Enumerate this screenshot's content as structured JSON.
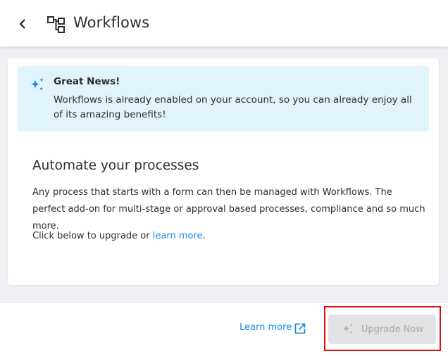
{
  "header": {
    "back_icon": "chevron-left-icon",
    "app_icon": "workflow-icon",
    "title": "Workflows"
  },
  "notice": {
    "icon": "sparkle-icon",
    "title": "Great News!",
    "body": "Workflows is already enabled on your account, so you can already enjoy all of its amazing benefits!",
    "background": "#e1f4fb",
    "icon_color": "#1b8ae0"
  },
  "main": {
    "title": "Automate your processes",
    "description": "Any process that starts with a form can then be managed with Workflows. The perfect add-on for multi-stage or approval based processes, compliance and so much more.",
    "upgrade_prefix": "Click below to upgrade or ",
    "upgrade_link": "learn more",
    "upgrade_suffix": "."
  },
  "footer": {
    "learn_more_label": "Learn more",
    "learn_more_icon": "external-link-icon",
    "upgrade_button_label": "Upgrade Now",
    "upgrade_button_icon": "sparkle-icon",
    "upgrade_button_disabled": true,
    "link_color": "#1b8ae0",
    "highlight_color": "#e01010"
  }
}
